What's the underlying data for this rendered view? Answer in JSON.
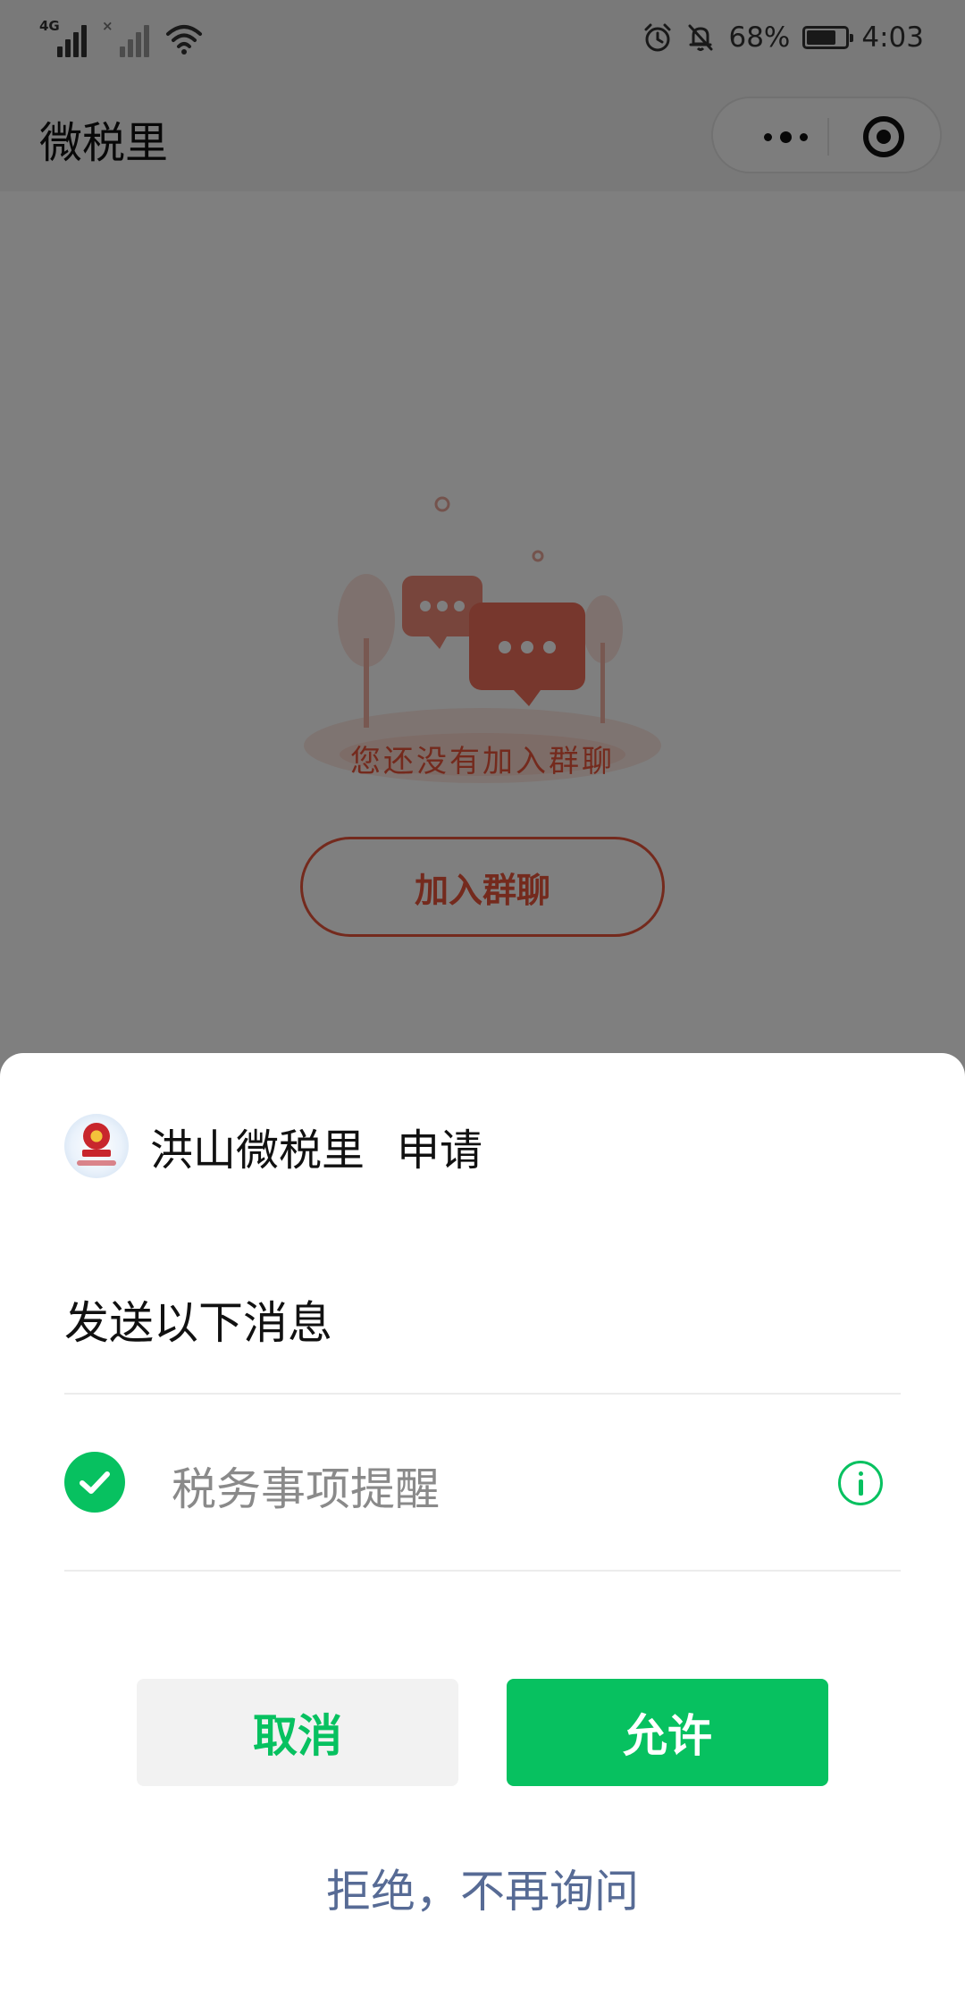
{
  "status_bar": {
    "network_1": "4G",
    "network_2": "×",
    "battery_level": "68%",
    "time": "4:03"
  },
  "navbar": {
    "title": "微税里"
  },
  "background_page": {
    "empty_text": "您还没有加入群聊",
    "join_button": "加入群聊"
  },
  "sheet": {
    "app_name": "洪山微税里",
    "request_label": "申请",
    "subtitle": "发送以下消息",
    "option": {
      "label": "税务事项提醒",
      "checked": true
    },
    "cancel_label": "取消",
    "allow_label": "允许",
    "reject_label": "拒绝，不再询问"
  },
  "colors": {
    "primary_green": "#07c160",
    "link_blue": "#576b95",
    "accent_red": "#e8553b"
  }
}
